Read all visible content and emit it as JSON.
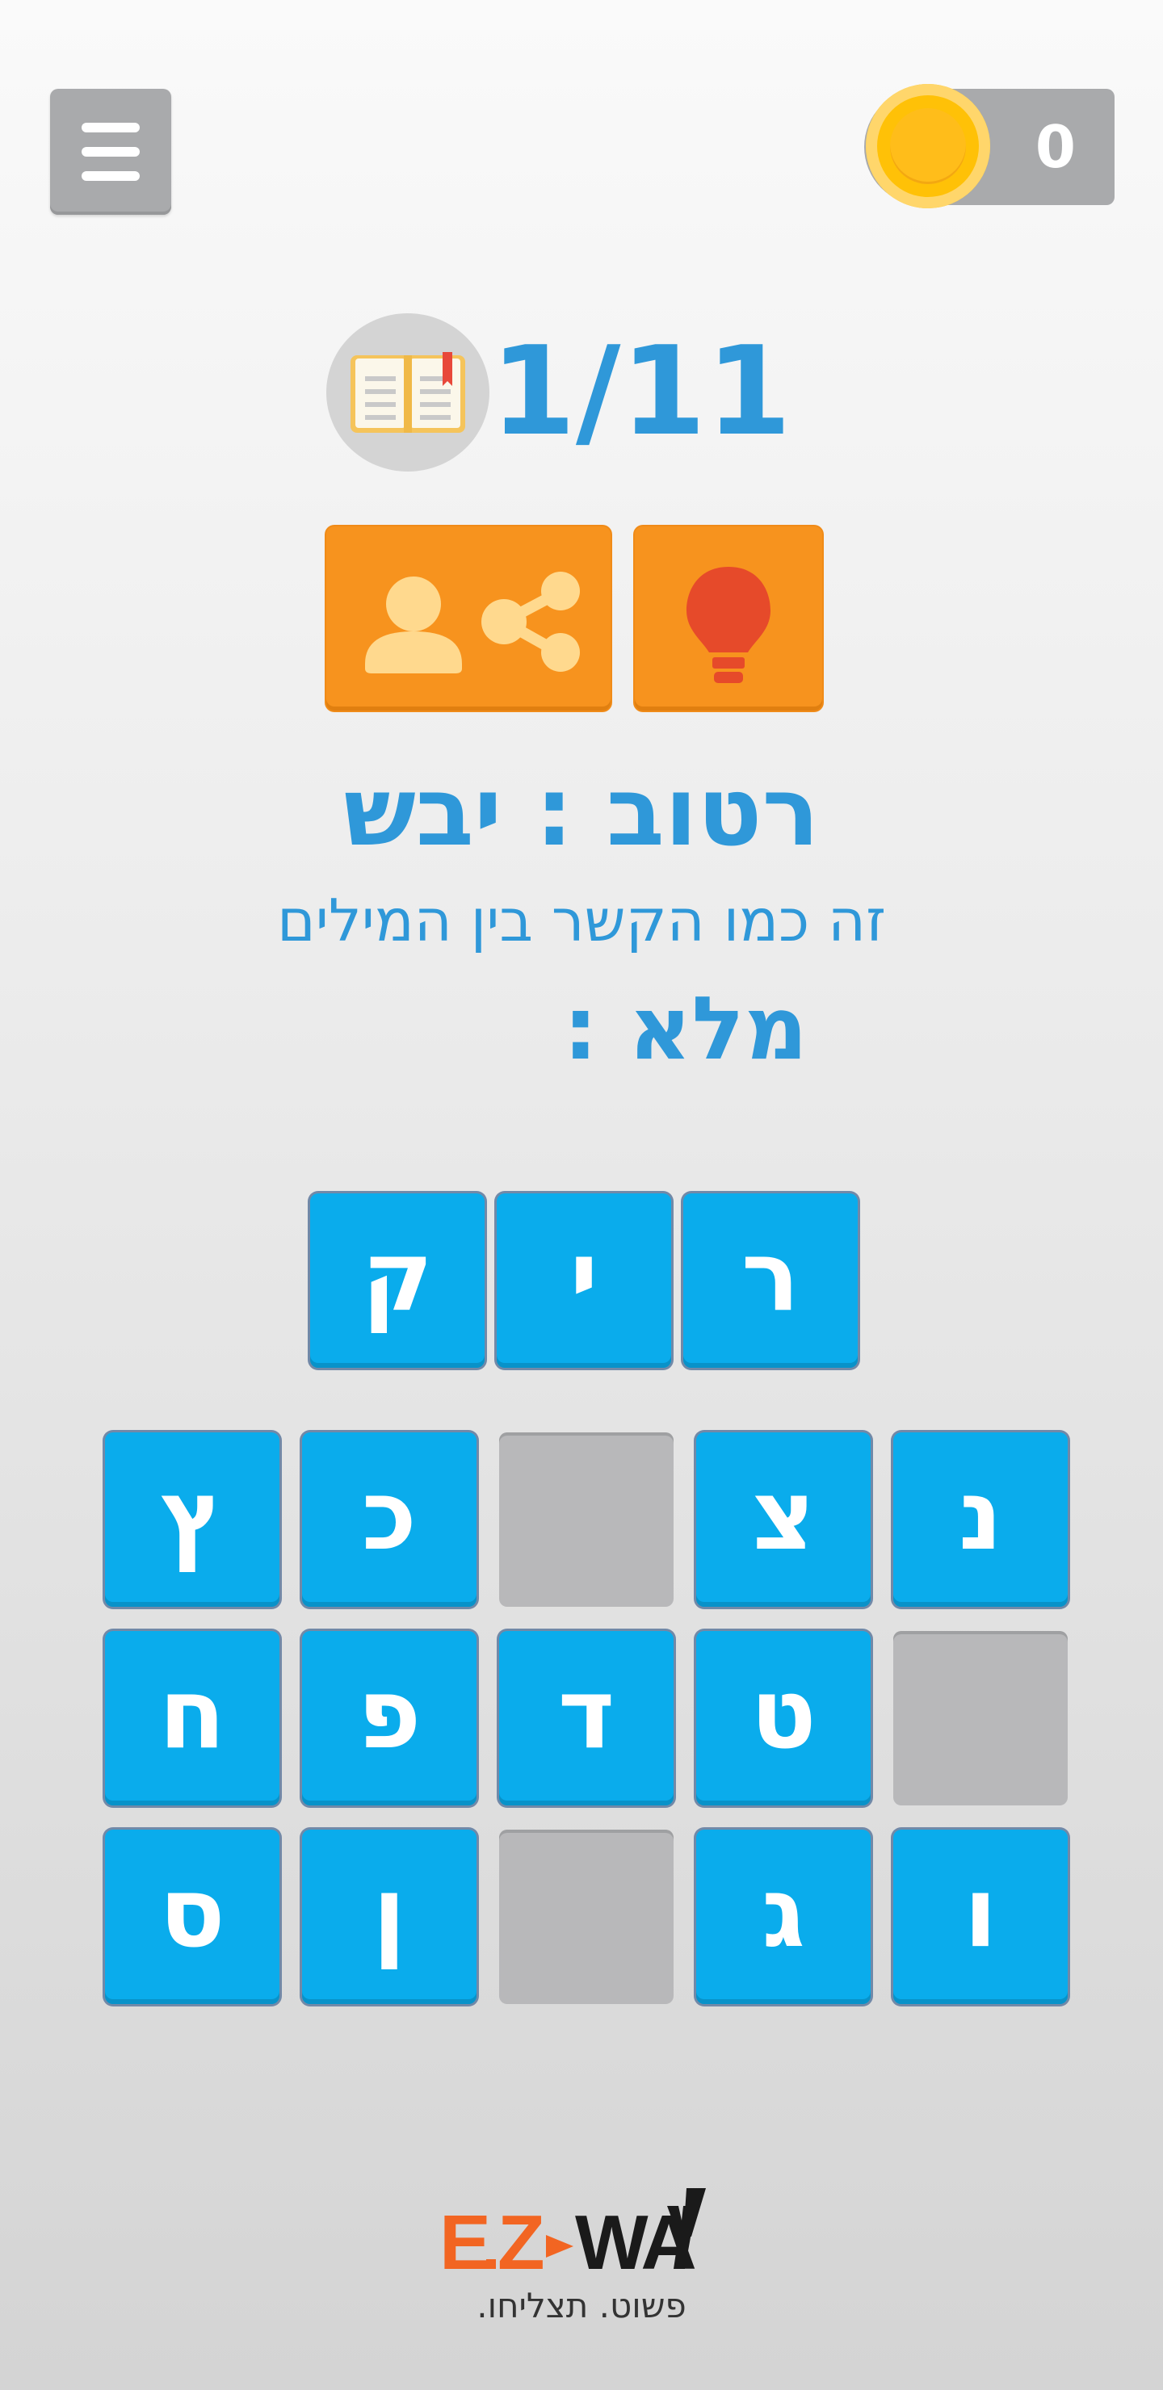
{
  "header": {
    "menu_icon": "hamburger-menu-icon",
    "coins": "0",
    "coin_icon": "gold-coin-icon"
  },
  "level": {
    "progress": "1/11",
    "book_icon": "open-book-icon"
  },
  "actions": {
    "share_icon": "person-share-icon",
    "hint_icon": "light-bulb-icon"
  },
  "clue": {
    "pair": "רטוב : יבש",
    "description": "זה כמו הקשר בין המילים",
    "fill": "מלא :"
  },
  "answer": {
    "letters": [
      "ר",
      "י",
      "ק"
    ]
  },
  "board": {
    "row1": [
      "נ",
      "צ",
      "",
      "כ",
      "ץ"
    ],
    "row2": [
      "",
      "ט",
      "ד",
      "פ",
      "ח"
    ],
    "row3": [
      "ו",
      "ג",
      "",
      "ן",
      "ס"
    ]
  },
  "logo": {
    "brand": "E.Z WAY",
    "tagline": "פשוט. תצליחו."
  },
  "colors": {
    "title_blue": "#2f98d9",
    "tile_blue": "#0aacec",
    "accent_orange": "#f7931e",
    "empty_gray": "#b8b8ba"
  }
}
